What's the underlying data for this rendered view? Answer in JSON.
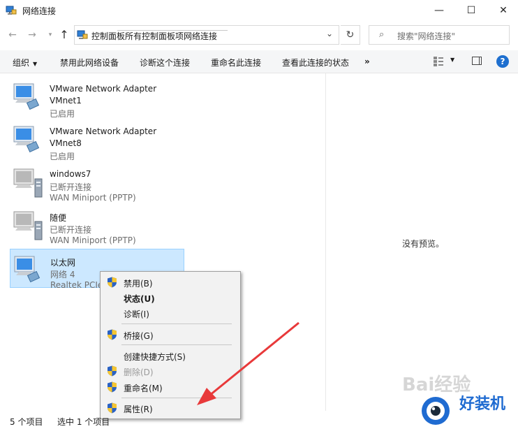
{
  "window": {
    "title": "网络连接",
    "min_glyph": "—",
    "max_glyph": "☐",
    "close_glyph": "✕"
  },
  "nav": {
    "back_glyph": "←",
    "forward_glyph": "→",
    "recent_glyph": "▾",
    "up_glyph": "↑"
  },
  "address": {
    "breadcrumbs": [
      "控制面板",
      "所有控制面板项",
      "网络连接"
    ],
    "sep_glyph": "›",
    "dropdown_glyph": "⌄",
    "refresh_glyph": "↻"
  },
  "search": {
    "icon_glyph": "⌕",
    "placeholder": "搜索\"网络连接\""
  },
  "toolbar": {
    "organize": "组织",
    "disable": "禁用此网络设备",
    "diagnose": "诊断这个连接",
    "rename": "重命名此连接",
    "status": "查看此连接的状态",
    "more": "»",
    "dropdown_glyph": "▼",
    "help_glyph": "?"
  },
  "connections": [
    {
      "name": "VMware Network Adapter",
      "line2": "VMnet1",
      "line3": "已启用",
      "kind": "ethernet"
    },
    {
      "name": "VMware Network Adapter",
      "line2": "VMnet8",
      "line3": "已启用",
      "kind": "ethernet"
    },
    {
      "name": "windows7",
      "line2": "已断开连接",
      "line3": "WAN Miniport (PPTP)",
      "kind": "vpn"
    },
    {
      "name": "随便",
      "line2": "已断开连接",
      "line3": "WAN Miniport (PPTP)",
      "kind": "vpn"
    },
    {
      "name": "以太网",
      "line2": "网络 4",
      "line3": "Realtek PCIe",
      "kind": "ethernet"
    }
  ],
  "preview": {
    "empty_text": "没有预览。"
  },
  "context_menu": {
    "items": [
      {
        "label": "禁用(B)",
        "shield": true,
        "disabled": false,
        "bold": false
      },
      {
        "label": "状态(U)",
        "shield": false,
        "disabled": false,
        "bold": true
      },
      {
        "label": "诊断(I)",
        "shield": false,
        "disabled": false,
        "bold": false
      },
      {
        "label": "桥接(G)",
        "shield": true,
        "disabled": false,
        "bold": false
      },
      {
        "label": "创建快捷方式(S)",
        "shield": false,
        "disabled": false,
        "bold": false
      },
      {
        "label": "删除(D)",
        "shield": true,
        "disabled": true,
        "bold": false
      },
      {
        "label": "重命名(M)",
        "shield": true,
        "disabled": false,
        "bold": false
      },
      {
        "label": "属性(R)",
        "shield": true,
        "disabled": false,
        "bold": false
      }
    ]
  },
  "statusbar": {
    "count": "5 个项目",
    "selected": "选中 1 个项目"
  },
  "watermark": {
    "text1": "Bai经验",
    "text2": "好装机"
  },
  "colors": {
    "selection_bg": "#cce8ff",
    "selection_border": "#99d1ff",
    "annotation_arrow": "#e8393a",
    "help_blue": "#1e6fcf"
  }
}
